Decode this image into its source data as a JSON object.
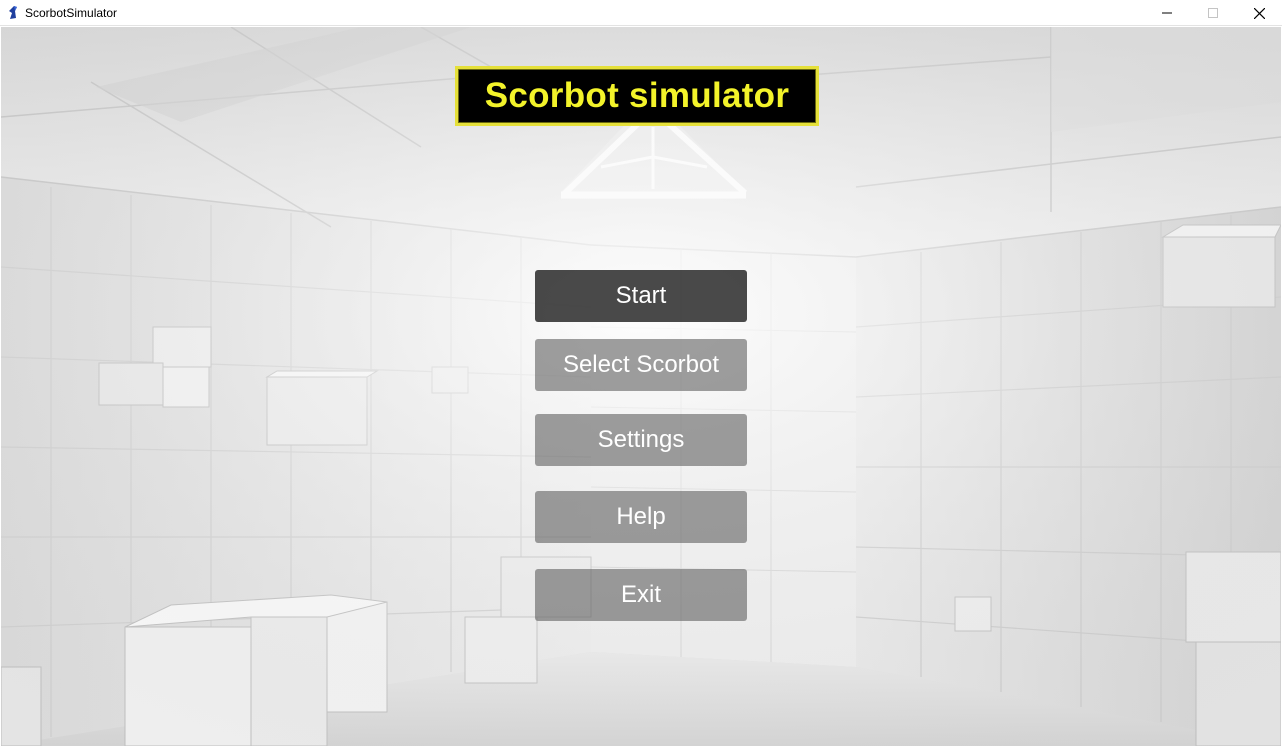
{
  "window": {
    "title": "ScorbotSimulator",
    "app_icon": "scorbot-arm-icon",
    "controls": [
      "minimize-icon",
      "maximize-icon",
      "close-icon"
    ]
  },
  "main_menu": {
    "title": "Scorbot simulator",
    "buttons": [
      "Start",
      "Select Scorbot",
      "Settings",
      "Help",
      "Exit"
    ],
    "active_button": "Start"
  },
  "colors": {
    "title_text": "#f3f32a",
    "title_border": "#e5e03a",
    "title_background": "#000000",
    "active_button": "#303030",
    "button": "#5f5f5f",
    "button_text": "#ffffff"
  }
}
